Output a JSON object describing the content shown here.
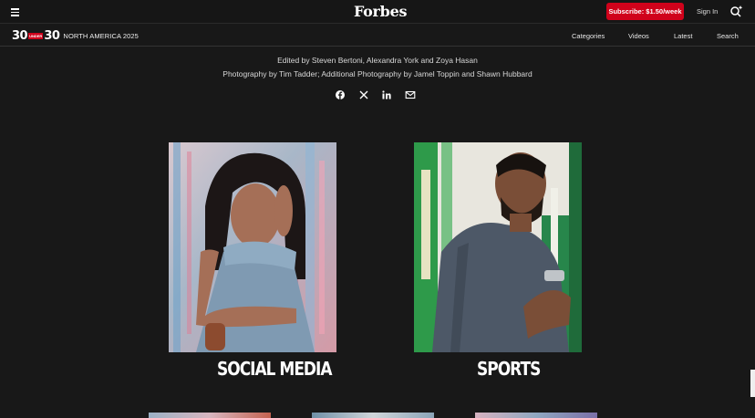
{
  "header": {
    "logo": "Forbes",
    "subscribe_label": "Subscribe: $1.50/week",
    "signin_label": "Sign In"
  },
  "subnav": {
    "brand_left": "30",
    "brand_under": "UNDER",
    "brand_right": "30",
    "brand_region": "NORTH AMERICA 2025",
    "links": [
      "Categories",
      "Videos",
      "Latest",
      "Search"
    ]
  },
  "credits": {
    "editors": "Edited by Steven Bertoni, Alexandra York and Zoya Hasan",
    "photography": "Photography by Tim Tadder; Additional Photography by Jamel Toppin and Shawn Hubbard"
  },
  "share": [
    "facebook-icon",
    "x-icon",
    "linkedin-icon",
    "email-icon"
  ],
  "categories": [
    {
      "label": "SOCIAL MEDIA"
    },
    {
      "label": "SPORTS"
    }
  ],
  "colors": {
    "accent": "#d0021b",
    "background": "#181818"
  }
}
